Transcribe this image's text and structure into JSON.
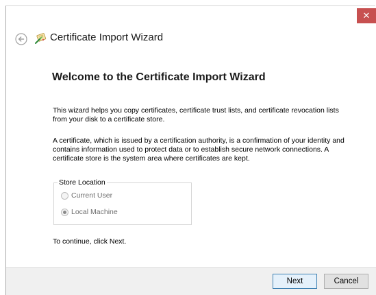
{
  "window": {
    "close_glyph": "✕",
    "title": "Certificate Import Wizard"
  },
  "icons": {
    "back": "back-arrow-icon",
    "wizard": "certificate-wizard-icon",
    "close": "close-icon"
  },
  "page": {
    "heading": "Welcome to the Certificate Import Wizard",
    "paragraph1": "This wizard helps you copy certificates, certificate trust lists, and certificate revocation lists from your disk to a certificate store.",
    "paragraph2": "A certificate, which is issued by a certification authority, is a confirmation of your identity and contains information used to protect data or to establish secure network connections. A certificate store is the system area where certificates are kept.",
    "store_location": {
      "legend": "Store Location",
      "options": [
        {
          "label": "Current User",
          "checked": false,
          "enabled": false
        },
        {
          "label": "Local Machine",
          "checked": true,
          "enabled": false
        }
      ]
    },
    "continue_text": "To continue, click Next."
  },
  "footer": {
    "next_label": "Next",
    "cancel_label": "Cancel"
  },
  "colors": {
    "close_button": "#c75050",
    "default_button_border": "#3c7fb1",
    "footer_bg": "#f0f0f0"
  }
}
